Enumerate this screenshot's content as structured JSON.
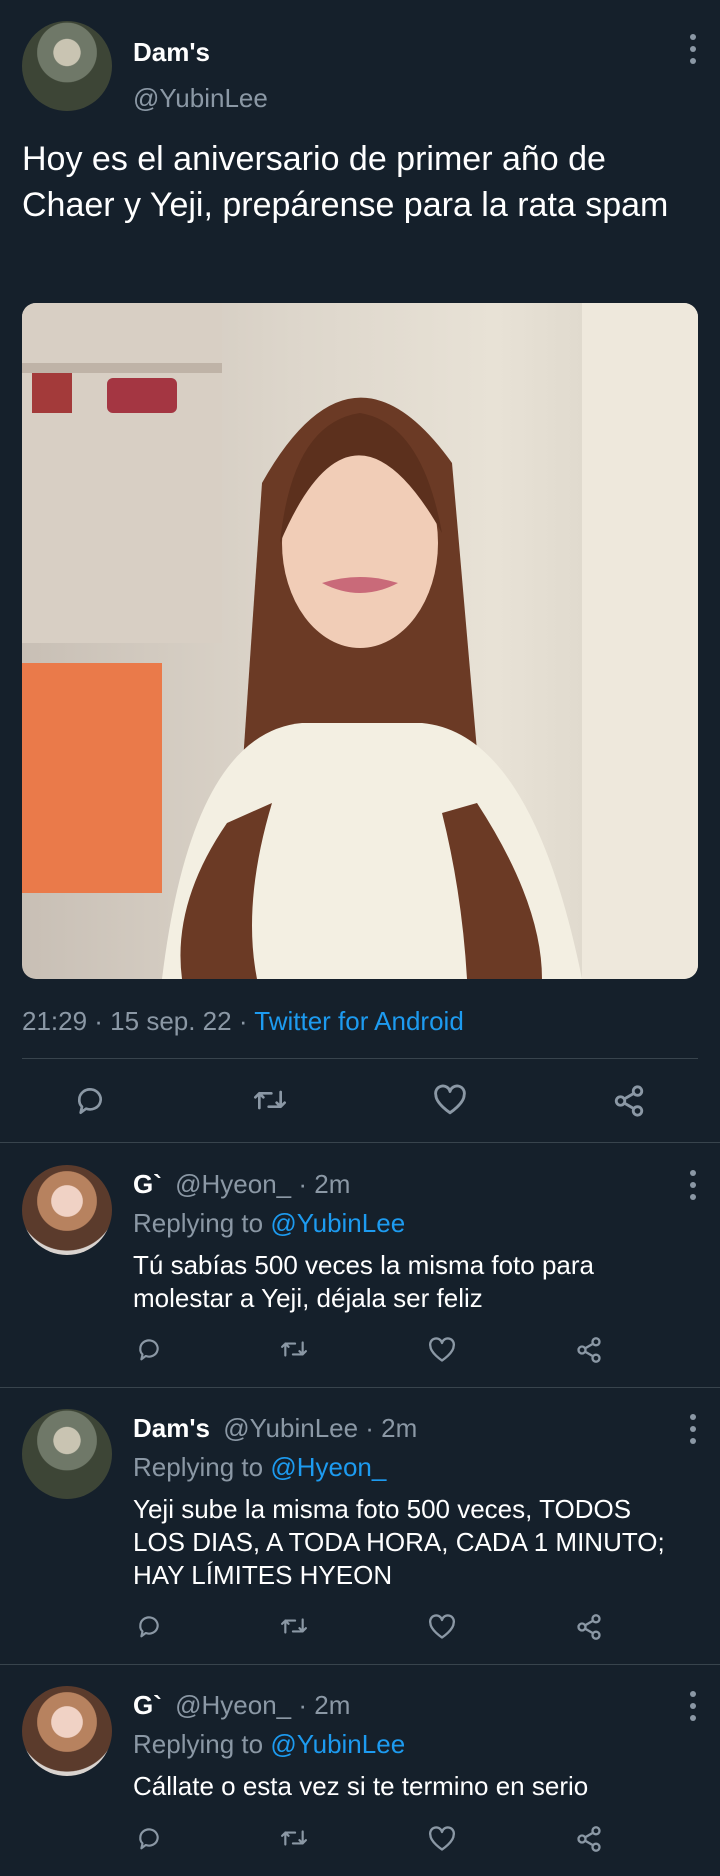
{
  "main_tweet": {
    "author_name": "Dam's",
    "author_handle": "@YubinLee",
    "text": "Hoy es el aniversario de primer año de Chaer y Yeji, prepárense para la rata spam",
    "timestamp": "21:29 · 15 sep. 22 · ",
    "source": "Twitter for Android"
  },
  "replies": [
    {
      "author_name": "G`",
      "meta": "@Hyeon_ · 2m",
      "replying_prefix": "Replying to ",
      "replying_to": "@YubinLee",
      "text_lines": [
        "Tú sabías 500 veces la misma foto para",
        "molestar a Yeji, déjala ser feliz"
      ]
    },
    {
      "author_name": "Dam's",
      "meta": "@YubinLee · 2m",
      "replying_prefix": "Replying to ",
      "replying_to": "@Hyeon_",
      "text_lines": [
        "Yeji sube la misma foto 500 veces, TODOS",
        "LOS DIAS, A TODA HORA, CADA 1 MINUTO;",
        "HAY LÍMITES HYEON"
      ]
    },
    {
      "author_name": "G`",
      "meta": "@Hyeon_ · 2m",
      "replying_prefix": "Replying to ",
      "replying_to": "@YubinLee",
      "text_lines": [
        "Cállate o esta vez si te termino en serio"
      ]
    }
  ],
  "icons": {
    "reply": "reply-icon",
    "retweet": "retweet-icon",
    "like": "heart-icon",
    "share": "share-icon",
    "more": "more-vertical-icon"
  },
  "colors": {
    "background": "#15202b",
    "accent": "#1d9bf0",
    "muted": "#8b98a5",
    "divider": "#38444d"
  }
}
